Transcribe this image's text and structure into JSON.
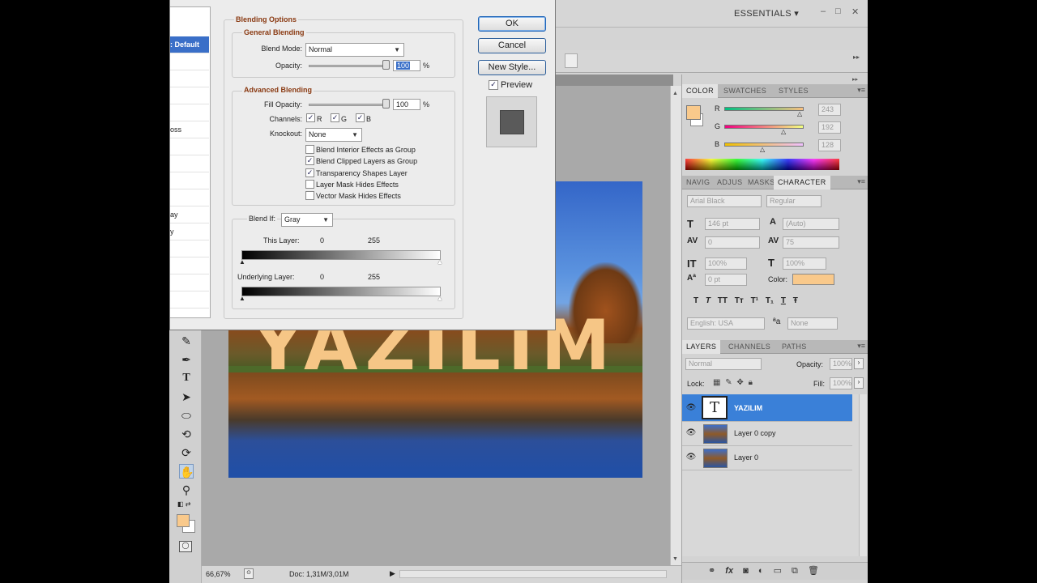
{
  "app": {
    "workspace": "ESSENTIALS",
    "window_controls": [
      "–",
      "□",
      "✕"
    ]
  },
  "document": {
    "text_layer_content": "YAZILIM",
    "zoom": "66,67%",
    "doc_size": "Doc: 1,31M/3,01M"
  },
  "styles_list": [
    {
      "label": ": Default"
    },
    {
      "label": ""
    },
    {
      "label": ""
    },
    {
      "label": ""
    },
    {
      "label": ""
    },
    {
      "label": "oss"
    },
    {
      "label": ""
    },
    {
      "label": ""
    },
    {
      "label": ""
    },
    {
      "label": ""
    },
    {
      "label": ""
    },
    {
      "label": "ay"
    },
    {
      "label": "y"
    },
    {
      "label": ""
    },
    {
      "label": ""
    },
    {
      "label": ""
    },
    {
      "label": ""
    },
    {
      "label": ""
    }
  ],
  "dialog": {
    "section_title": "Blending Options",
    "general": {
      "title": "General Blending",
      "blend_mode_label": "Blend Mode:",
      "blend_mode_value": "Normal",
      "opacity_label": "Opacity:",
      "opacity_value": "100",
      "percent": "%"
    },
    "advanced": {
      "title": "Advanced Blending",
      "fill_opacity_label": "Fill Opacity:",
      "fill_opacity_value": "100",
      "percent": "%",
      "channels_label": "Channels:",
      "channels": [
        {
          "label": "R",
          "checked": true
        },
        {
          "label": "G",
          "checked": true
        },
        {
          "label": "B",
          "checked": true
        }
      ],
      "knockout_label": "Knockout:",
      "knockout_value": "None",
      "options": [
        {
          "label": "Blend Interior Effects as Group",
          "checked": false
        },
        {
          "label": "Blend Clipped Layers as Group",
          "checked": true
        },
        {
          "label": "Transparency Shapes Layer",
          "checked": true
        },
        {
          "label": "Layer Mask Hides Effects",
          "checked": false
        },
        {
          "label": "Vector Mask Hides Effects",
          "checked": false
        }
      ]
    },
    "blend_if": {
      "label": "Blend If:",
      "value": "Gray",
      "this_layer_label": "This Layer:",
      "this_layer_min": "0",
      "this_layer_max": "255",
      "underlying_label": "Underlying Layer:",
      "underlying_min": "0",
      "underlying_max": "255"
    },
    "buttons": {
      "ok": "OK",
      "cancel": "Cancel",
      "new_style": "New Style...",
      "preview_label": "Preview",
      "preview_checked": true
    }
  },
  "color_panel": {
    "tabs": [
      "COLOR",
      "SWATCHES",
      "STYLES"
    ],
    "foreground": "#f9c98b",
    "channels": [
      {
        "label": "R",
        "value": "243",
        "level": 0.95
      },
      {
        "label": "G",
        "value": "192",
        "level": 0.75
      },
      {
        "label": "B",
        "value": "128",
        "level": 0.5
      }
    ]
  },
  "character_panel": {
    "tabs": [
      "NAVIG",
      "ADJUS",
      "MASKS",
      "CHARACTER"
    ],
    "font_family": "Arial Black",
    "font_style": "Regular",
    "font_size": "146 pt",
    "leading": "(Auto)",
    "kerning": "0",
    "tracking": "75",
    "vertical_scale": "100%",
    "horizontal_scale": "100%",
    "baseline_shift": "0 pt",
    "color_label": "Color:",
    "color_value": "#f9c98b",
    "style_buttons": [
      "T",
      "T",
      "TT",
      "Tт",
      "T¹",
      "T₁",
      "T",
      "Ŧ"
    ],
    "language": "English: USA",
    "aa_label": "ªa",
    "antialias": "None"
  },
  "layers_panel": {
    "tabs": [
      "LAYERS",
      "CHANNELS",
      "PATHS"
    ],
    "blend_mode": "Normal",
    "opacity_label": "Opacity:",
    "opacity_value": "100%",
    "lock_label": "Lock:",
    "fill_label": "Fill:",
    "fill_value": "100%",
    "layers": [
      {
        "name": "YAZILIM",
        "kind": "text",
        "selected": true
      },
      {
        "name": "Layer 0 copy",
        "kind": "image",
        "selected": false
      },
      {
        "name": "Layer 0",
        "kind": "image",
        "selected": false
      }
    ],
    "footer_icons": [
      "link-icon",
      "fx-icon",
      "mask-icon",
      "adjustment-icon",
      "group-icon",
      "new-layer-icon",
      "trash-icon"
    ]
  },
  "toolbar": {
    "tools": [
      "eyedropper-icon",
      "pen-icon",
      "type-icon",
      "path-select-icon",
      "ellipse-icon",
      "rotate-3d-icon",
      "orbit-3d-icon",
      "hand-icon",
      "zoom-icon"
    ]
  }
}
